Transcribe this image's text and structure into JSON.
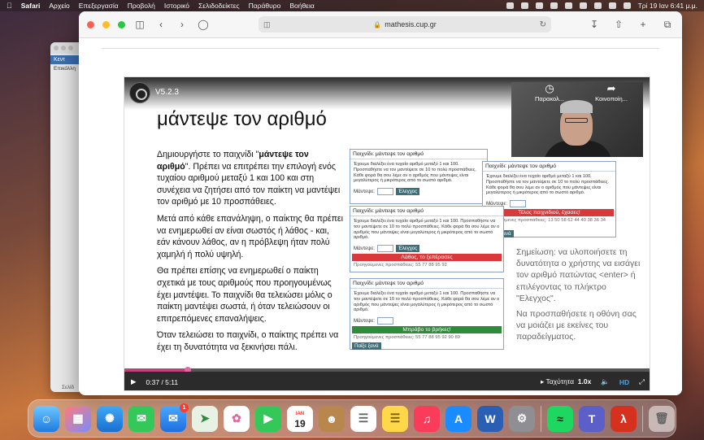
{
  "menubar": {
    "apple": "",
    "app": "Safari",
    "items": [
      "Αρχείο",
      "Επεξεργασία",
      "Προβολή",
      "Ιστορικό",
      "Σελιδοδείκτες",
      "Παράθυρο",
      "Βοήθεια"
    ],
    "clock": "Τρί 19 Ιαν  6:41 μ.μ."
  },
  "bgwindow": {
    "tab": "Κεντ",
    "paste": "Επικόλλη",
    "footer": "Σελίδ"
  },
  "safari": {
    "url": "mathesis.cup.gr"
  },
  "video": {
    "title": "V5.2.3",
    "slide_title": "μάντεψε τον αριθμό",
    "paragraph1_a": "Δημιουργήστε το παιχνίδι \"",
    "paragraph1_b": "μάντεψε τον αριθμό",
    "paragraph1_c": "\". Πρέπει να επιτρέπει την επιλογή ενός τυχαίου αριθμού μεταξύ 1 και 100 και στη συνέχεια να ζητήσει από τον παίκτη να μαντέψει τον αριθμό με 10 προσπάθειες.",
    "paragraph2": "Μετά από κάθε επανάληψη, ο παίκτης θα πρέπει να ενημερωθεί αν είναι σωστός ή λάθος - και, εάν κάνουν λάθος, αν η πρόβλεψη ήταν πολύ χαμηλή ή πολύ υψηλή.",
    "paragraph3": "Θα πρέπει επίσης να ενημερωθεί ο παίκτη σχετικά με τους αριθμούς που προηγουμένως έχει μαντέψει. Το παιχνίδι θα τελειώσει μόλις ο παίκτη μαντέψει σωστά, ή όταν τελειώσουν οι επιτρεπόμενες επαναλήψεις.",
    "paragraph4": "Όταν τελειώσει το παιχνίδι, ο παίκτης πρέπει να έχει τη δυνατότητα να ξεκινήσει πάλι.",
    "note1": "Σημείωση: να υλοποιήσετε τη δυνατότητα ο χρήστης να εισάγει τον αριθμό πατώντας <enter> ή επιλέγοντας το πλήκτρο \"Ελεγχος\".",
    "note2": "Να προσπαθήσετε η οθόνη σας να μοιάζει με εκείνες του παραδείγματος.",
    "watch_later": "Παρακολ...",
    "share": "Κοινοποίη...",
    "youtube": "YouTube",
    "time": "0:37 / 5:11",
    "progress": 0.12,
    "speed_label": "Ταχύτητα",
    "speed_value": "1.0x",
    "hd": "HD"
  },
  "game": {
    "title": "Παιχνίδι: μάντεψε τον αριθμό",
    "desc": "Έχουμε διαλέξει ένα τυχαίο αριθμό μεταξύ 1 και 100. Προσπαθήστε να τον μαντέψετε σε 10 το πολύ προσπάθειες. Κάθε φορά θα σου λέμε αν ο αριθμός που μάντεψες είναι μεγαλύτερος ή μικρότερος από το σωστό αριθμό.",
    "guess_label": "Μάντεψε:",
    "check": "Έλεγχος",
    "end_msg": "Τέλος παιχνιδιού, έχασες!",
    "end_prev": "Προηγούμενες προσπάθειες: 13 50 58 62 44 40 38 36 34 30",
    "wrong_msg": "Λάθος, το ξεπέρασες",
    "wrong_prev": "Προηγούμενες προσπάθειες: 55 77 88 95 92",
    "right_msg": "Μπράβο το βρήκες!",
    "right_prev": "Προηγούμενες προσπάθειες: 55 77 88 95 92 90 89",
    "again": "Παίξε ξανά"
  },
  "dock": {
    "calendar_month": "ΙΑΝ",
    "calendar_day": "19",
    "mail_badge": "1"
  }
}
